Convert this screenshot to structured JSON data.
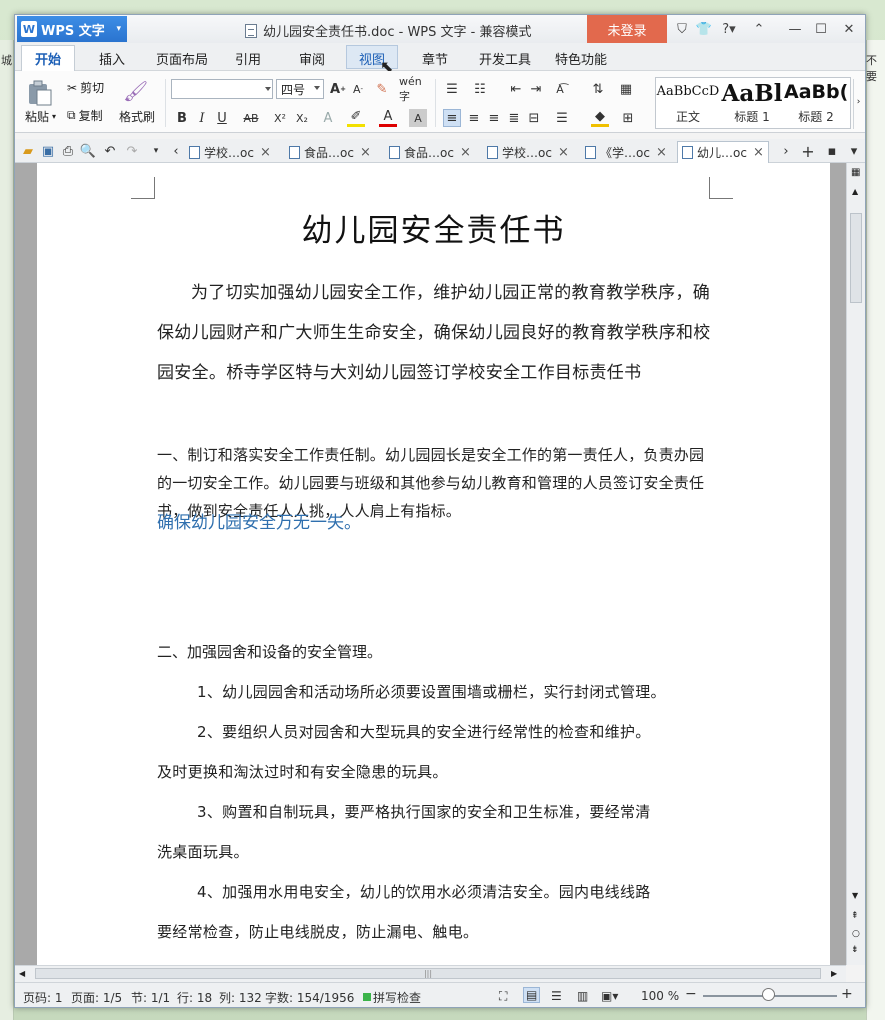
{
  "app": {
    "name": "WPS 文字",
    "title": "幼儿园安全责任书.doc - WPS 文字 - 兼容模式",
    "login": "未登录"
  },
  "menu": [
    "开始",
    "插入",
    "页面布局",
    "引用",
    "审阅",
    "视图",
    "章节",
    "开发工具",
    "特色功能"
  ],
  "ribbon": {
    "paste": "粘贴",
    "cut": "剪切",
    "copy": "复制",
    "format_painter": "格式刷",
    "font_name": "",
    "font_size": "四号",
    "styles": [
      {
        "preview": "AaBbCcD",
        "name": "正文"
      },
      {
        "preview": "AaBl",
        "name": "标题 1"
      },
      {
        "preview": "AaBb(",
        "name": "标题 2"
      }
    ]
  },
  "doc_tabs": [
    "学校…oc",
    "食品…oc",
    "食品…oc",
    "学校…oc",
    "《学…oc",
    "幼儿…oc"
  ],
  "document": {
    "title": "幼儿园安全责任书",
    "intro": "为了切实加强幼儿园安全工作，维护幼儿园正常的教育教学秩序，确保幼儿园财产和广大师生生命安全，确保幼儿园良好的教育教学秩序和校园安全。桥寺学区特与大刘幼儿园签订学校安全工作目标责任书",
    "s1": "一、制订和落实安全工作责任制。幼儿园园长是安全工作的第一责任人，负责办园的一切安全工作。幼儿园要与班级和其他参与幼儿教育和管理的人员签订安全责任书，做到安全责任人人挑，人人肩上有指标。",
    "s1_tail": "确保幼儿园安全万无一失。",
    "s2": "二、加强园舍和设备的安全管理。",
    "item1": "1、幼儿园园舍和活动场所必须要设置围墙或栅栏，实行封闭式管理。",
    "item2a": "2、要组织人员对园舍和大型玩具的安全进行经常性的检查和维护。",
    "item2b": "及时更换和淘汰过时和有安全隐患的玩具。",
    "item3a": "3、购置和自制玩具，要严格执行国家的安全和卫生标准，要经常清",
    "item3b": "洗桌面玩具。",
    "item4a": "4、加强用水用电安全，幼儿的饮用水必须清洁安全。园内电线线路",
    "item4b": "要经常检查，防止电线脱皮，防止漏电、触电。"
  },
  "status": {
    "page_code": "页码: 1",
    "page": "页面: 1/5",
    "section": "节: 1/1",
    "row": "行: 18",
    "col": "列: 132",
    "words": "字数: 154/1956",
    "spell": "拼写检查",
    "zoom": "100 %"
  },
  "background": {
    "left_text": "城",
    "right_text": "不要"
  },
  "colors": {
    "accent": "#2a74cf",
    "login": "#e2694d",
    "link_text": "#2f6fae"
  }
}
